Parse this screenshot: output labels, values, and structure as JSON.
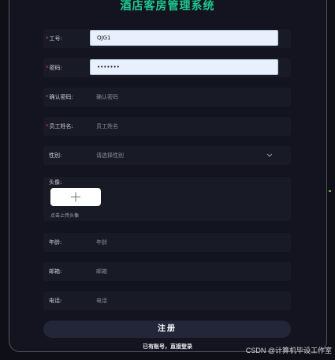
{
  "app": {
    "title": "酒店客房管理系统"
  },
  "form": {
    "employee_id": {
      "label": "工号:",
      "value": "QJG1"
    },
    "password": {
      "label": "密码:",
      "value": "•••••••"
    },
    "confirm_password": {
      "label": "确认密码:",
      "placeholder": "确认密码"
    },
    "employee_name": {
      "label": "员工姓名:",
      "placeholder": "员工姓名"
    },
    "gender": {
      "label": "性别:",
      "placeholder": "请选择性别"
    },
    "avatar": {
      "label": "头像:",
      "upload_icon": "plus-icon",
      "tip": "点击上传头像"
    },
    "age": {
      "label": "年龄:",
      "placeholder": "年龄"
    },
    "email": {
      "label": "邮箱:",
      "placeholder": "邮箱"
    },
    "phone": {
      "label": "电话:",
      "placeholder": "电话"
    },
    "required_mark": "*"
  },
  "actions": {
    "register_label": "注册",
    "login_link": "已有账号，直接登录"
  },
  "watermark": "CSDN @计算机毕设工作室",
  "colors": {
    "title": "#1ec98e",
    "background": "#131420",
    "field_bg": "#181a26",
    "required": "#e04b4b"
  }
}
